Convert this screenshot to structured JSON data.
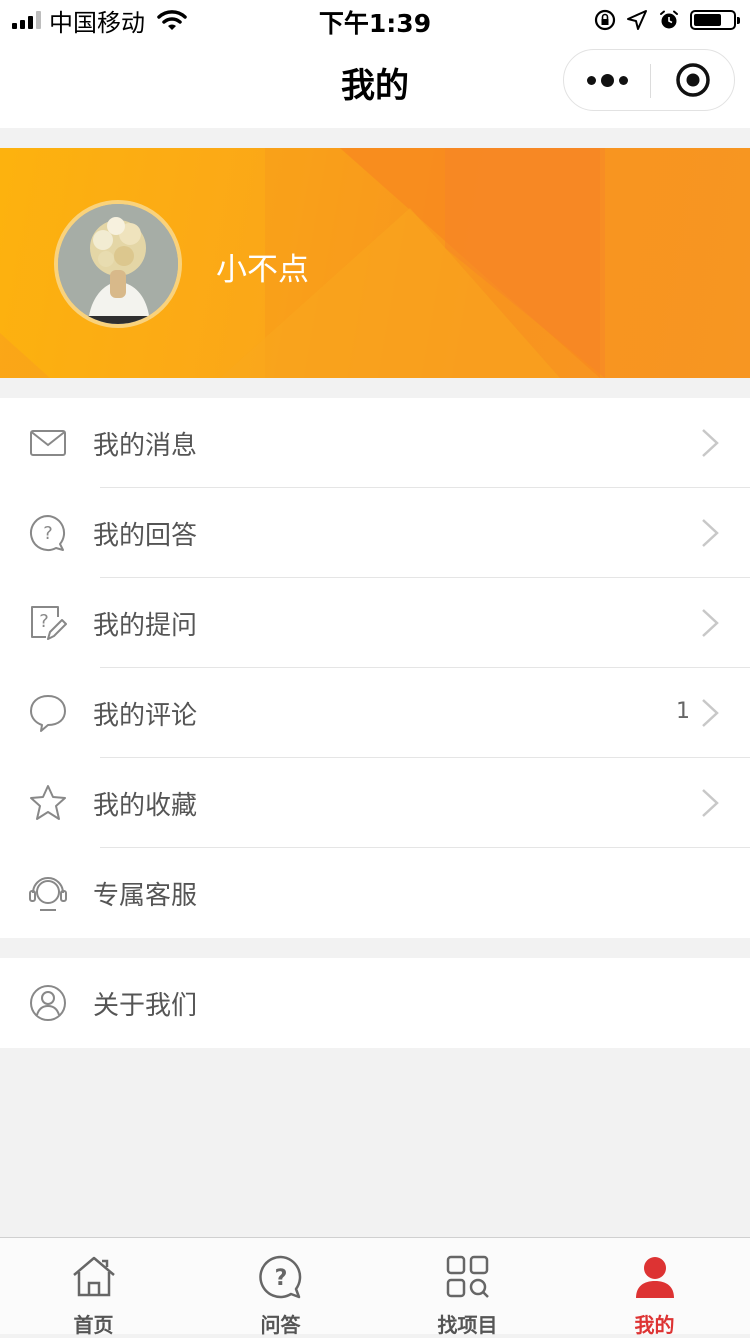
{
  "status_bar": {
    "carrier": "中国移动",
    "time": "下午1:39"
  },
  "nav": {
    "title": "我的"
  },
  "profile": {
    "username": "小不点"
  },
  "menu": [
    {
      "label": "我的消息",
      "icon": "envelope-icon",
      "count": ""
    },
    {
      "label": "我的回答",
      "icon": "question-bubble-icon",
      "count": ""
    },
    {
      "label": "我的提问",
      "icon": "question-edit-icon",
      "count": ""
    },
    {
      "label": "我的评论",
      "icon": "comment-bubble-icon",
      "count": "1"
    },
    {
      "label": "我的收藏",
      "icon": "star-icon",
      "count": ""
    },
    {
      "label": "专属客服",
      "icon": "headset-icon",
      "count": ""
    }
  ],
  "menu2": [
    {
      "label": "关于我们",
      "icon": "user-circle-icon"
    }
  ],
  "tabbar": {
    "items": [
      {
        "label": "首页",
        "icon": "home-icon"
      },
      {
        "label": "问答",
        "icon": "question-circle-icon"
      },
      {
        "label": "找项目",
        "icon": "grid-search-icon"
      },
      {
        "label": "我的",
        "icon": "person-icon"
      }
    ],
    "active_color": "#dd3333"
  },
  "colors": {
    "banner_start": "#fdb20e",
    "banner_end": "#f7902a",
    "background": "#f2f2f2"
  }
}
